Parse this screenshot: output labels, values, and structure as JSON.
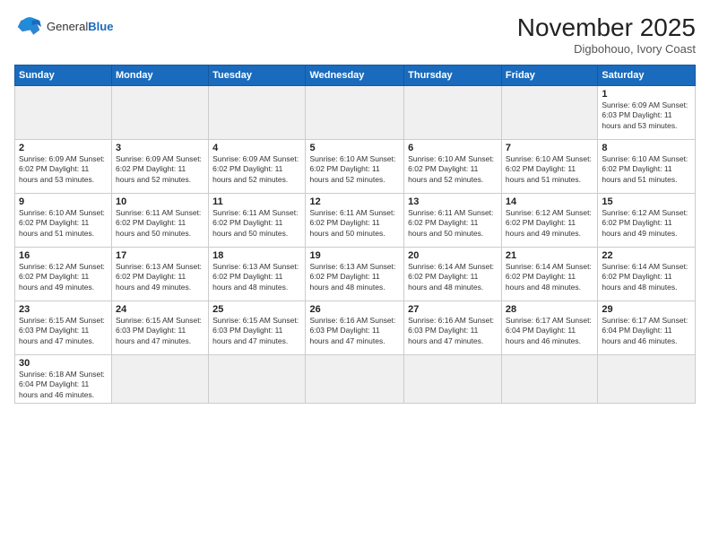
{
  "logo": {
    "general": "General",
    "blue": "Blue"
  },
  "title": "November 2025",
  "location": "Digbohouo, Ivory Coast",
  "weekdays": [
    "Sunday",
    "Monday",
    "Tuesday",
    "Wednesday",
    "Thursday",
    "Friday",
    "Saturday"
  ],
  "days": [
    {
      "num": "",
      "info": ""
    },
    {
      "num": "",
      "info": ""
    },
    {
      "num": "",
      "info": ""
    },
    {
      "num": "",
      "info": ""
    },
    {
      "num": "",
      "info": ""
    },
    {
      "num": "",
      "info": ""
    },
    {
      "num": "1",
      "info": "Sunrise: 6:09 AM\nSunset: 6:03 PM\nDaylight: 11 hours\nand 53 minutes."
    }
  ],
  "week2": [
    {
      "num": "2",
      "info": "Sunrise: 6:09 AM\nSunset: 6:02 PM\nDaylight: 11 hours\nand 53 minutes."
    },
    {
      "num": "3",
      "info": "Sunrise: 6:09 AM\nSunset: 6:02 PM\nDaylight: 11 hours\nand 52 minutes."
    },
    {
      "num": "4",
      "info": "Sunrise: 6:09 AM\nSunset: 6:02 PM\nDaylight: 11 hours\nand 52 minutes."
    },
    {
      "num": "5",
      "info": "Sunrise: 6:10 AM\nSunset: 6:02 PM\nDaylight: 11 hours\nand 52 minutes."
    },
    {
      "num": "6",
      "info": "Sunrise: 6:10 AM\nSunset: 6:02 PM\nDaylight: 11 hours\nand 52 minutes."
    },
    {
      "num": "7",
      "info": "Sunrise: 6:10 AM\nSunset: 6:02 PM\nDaylight: 11 hours\nand 51 minutes."
    },
    {
      "num": "8",
      "info": "Sunrise: 6:10 AM\nSunset: 6:02 PM\nDaylight: 11 hours\nand 51 minutes."
    }
  ],
  "week3": [
    {
      "num": "9",
      "info": "Sunrise: 6:10 AM\nSunset: 6:02 PM\nDaylight: 11 hours\nand 51 minutes."
    },
    {
      "num": "10",
      "info": "Sunrise: 6:11 AM\nSunset: 6:02 PM\nDaylight: 11 hours\nand 50 minutes."
    },
    {
      "num": "11",
      "info": "Sunrise: 6:11 AM\nSunset: 6:02 PM\nDaylight: 11 hours\nand 50 minutes."
    },
    {
      "num": "12",
      "info": "Sunrise: 6:11 AM\nSunset: 6:02 PM\nDaylight: 11 hours\nand 50 minutes."
    },
    {
      "num": "13",
      "info": "Sunrise: 6:11 AM\nSunset: 6:02 PM\nDaylight: 11 hours\nand 50 minutes."
    },
    {
      "num": "14",
      "info": "Sunrise: 6:12 AM\nSunset: 6:02 PM\nDaylight: 11 hours\nand 49 minutes."
    },
    {
      "num": "15",
      "info": "Sunrise: 6:12 AM\nSunset: 6:02 PM\nDaylight: 11 hours\nand 49 minutes."
    }
  ],
  "week4": [
    {
      "num": "16",
      "info": "Sunrise: 6:12 AM\nSunset: 6:02 PM\nDaylight: 11 hours\nand 49 minutes."
    },
    {
      "num": "17",
      "info": "Sunrise: 6:13 AM\nSunset: 6:02 PM\nDaylight: 11 hours\nand 49 minutes."
    },
    {
      "num": "18",
      "info": "Sunrise: 6:13 AM\nSunset: 6:02 PM\nDaylight: 11 hours\nand 48 minutes."
    },
    {
      "num": "19",
      "info": "Sunrise: 6:13 AM\nSunset: 6:02 PM\nDaylight: 11 hours\nand 48 minutes."
    },
    {
      "num": "20",
      "info": "Sunrise: 6:14 AM\nSunset: 6:02 PM\nDaylight: 11 hours\nand 48 minutes."
    },
    {
      "num": "21",
      "info": "Sunrise: 6:14 AM\nSunset: 6:02 PM\nDaylight: 11 hours\nand 48 minutes."
    },
    {
      "num": "22",
      "info": "Sunrise: 6:14 AM\nSunset: 6:02 PM\nDaylight: 11 hours\nand 48 minutes."
    }
  ],
  "week5": [
    {
      "num": "23",
      "info": "Sunrise: 6:15 AM\nSunset: 6:03 PM\nDaylight: 11 hours\nand 47 minutes."
    },
    {
      "num": "24",
      "info": "Sunrise: 6:15 AM\nSunset: 6:03 PM\nDaylight: 11 hours\nand 47 minutes."
    },
    {
      "num": "25",
      "info": "Sunrise: 6:15 AM\nSunset: 6:03 PM\nDaylight: 11 hours\nand 47 minutes."
    },
    {
      "num": "26",
      "info": "Sunrise: 6:16 AM\nSunset: 6:03 PM\nDaylight: 11 hours\nand 47 minutes."
    },
    {
      "num": "27",
      "info": "Sunrise: 6:16 AM\nSunset: 6:03 PM\nDaylight: 11 hours\nand 47 minutes."
    },
    {
      "num": "28",
      "info": "Sunrise: 6:17 AM\nSunset: 6:04 PM\nDaylight: 11 hours\nand 46 minutes."
    },
    {
      "num": "29",
      "info": "Sunrise: 6:17 AM\nSunset: 6:04 PM\nDaylight: 11 hours\nand 46 minutes."
    }
  ],
  "week6": [
    {
      "num": "30",
      "info": "Sunrise: 6:18 AM\nSunset: 6:04 PM\nDaylight: 11 hours\nand 46 minutes."
    },
    {
      "num": "",
      "info": ""
    },
    {
      "num": "",
      "info": ""
    },
    {
      "num": "",
      "info": ""
    },
    {
      "num": "",
      "info": ""
    },
    {
      "num": "",
      "info": ""
    },
    {
      "num": "",
      "info": ""
    }
  ]
}
